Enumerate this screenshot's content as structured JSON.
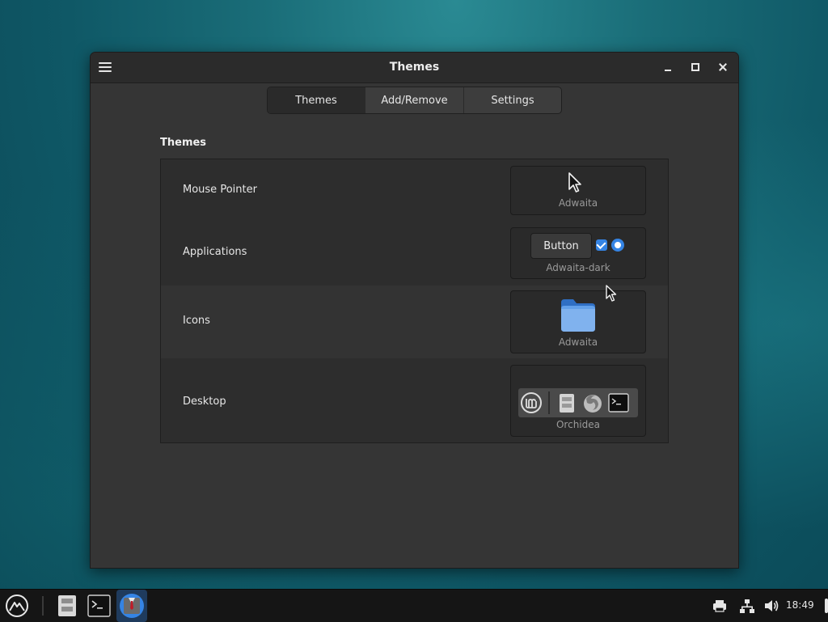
{
  "window": {
    "title": "Themes",
    "tabs": [
      {
        "label": "Themes",
        "active": true
      },
      {
        "label": "Add/Remove",
        "active": false
      },
      {
        "label": "Settings",
        "active": false
      }
    ],
    "section_title": "Themes"
  },
  "themes": {
    "mouse_pointer": {
      "label": "Mouse Pointer",
      "value": "Adwaita",
      "icon": "cursor-arrow-icon"
    },
    "applications": {
      "label": "Applications",
      "value": "Adwaita-dark",
      "preview_button": "Button"
    },
    "icons": {
      "label": "Icons",
      "value": "Adwaita",
      "icon": "folder-icon"
    },
    "desktop": {
      "label": "Desktop",
      "value": "Orchidea",
      "preview_icons": [
        "mint-logo-icon",
        "file-cabinet-icon",
        "firefox-icon",
        "terminal-icon"
      ]
    }
  },
  "taskbar": {
    "launchers": [
      "menu-logo-icon",
      "file-manager-icon",
      "terminal-icon",
      "themes-app-icon"
    ],
    "tray": [
      "printer-icon",
      "network-icon",
      "volume-icon",
      "power-icon"
    ],
    "clock": "18:49"
  },
  "colors": {
    "accent": "#3584e4",
    "folder": "#62a0ea"
  }
}
